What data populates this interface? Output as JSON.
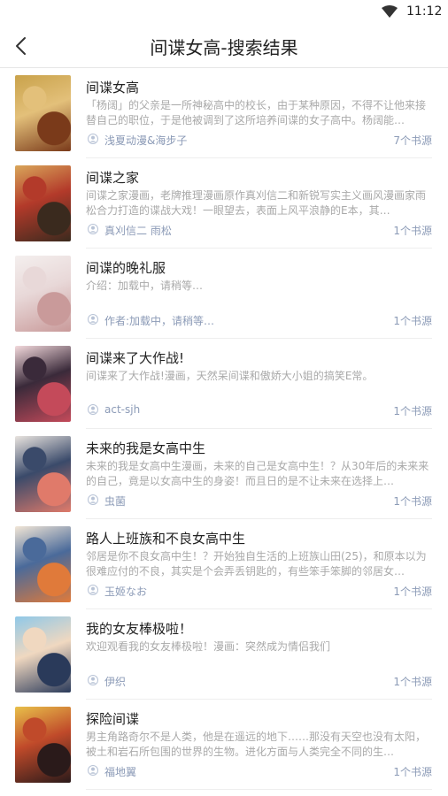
{
  "status": {
    "time": "11:12",
    "wifi_icon": "wifi-icon"
  },
  "toolbar": {
    "back_icon": "chevron-left-icon",
    "title": "间谍女高-搜索结果"
  },
  "results": [
    {
      "title": "间谍女高",
      "desc": "「杨阔」的父亲是一所神秘高中的校长，由于某种原因，不得不让他来接替自己的职位，于是他被调到了这所培养间谍的女子高中。杨阔能…",
      "author": "浅夏动漫&海步子",
      "sources": "7个书源",
      "cover_colors": [
        "#c9a24a",
        "#7a3a1a",
        "#e3c07a"
      ]
    },
    {
      "title": "间谍之家",
      "desc": "间谍之家漫画，老牌推理漫画原作真刈信二和新锐写实主义画风漫画家雨松合力打造的谍战大戏！一眼望去，表面上风平浪静的E本，其…",
      "author": "真刈信二 雨松",
      "sources": "1个书源",
      "cover_colors": [
        "#d9a65a",
        "#3a2a1e",
        "#b33a2a"
      ]
    },
    {
      "title": "间谍的晚礼服",
      "desc": "介绍：加载中，请稍等…",
      "author": "作者:加载中，请稍等…",
      "sources": "1个书源",
      "cover_colors": [
        "#f4efee",
        "#c99a9a",
        "#e8d8d8"
      ]
    },
    {
      "title": "间谍来了大作战!",
      "desc": "间谍来了大作战!漫画，天然呆间谍和傲娇大小姐的搞笑E常。",
      "author": "act-sjh",
      "sources": "1个书源",
      "cover_colors": [
        "#f3d9dc",
        "#c44a5a",
        "#3a2a3a"
      ]
    },
    {
      "title": "未来的我是女高中生",
      "desc": "未来的我是女高中生漫画，未来的自己是女高中生！？从30年后的未来来的自己，竟是以女高中生的身姿！而且日的是不让未来在选择上…",
      "author": "虫菌",
      "sources": "1个书源",
      "cover_colors": [
        "#e9e4df",
        "#e07a6a",
        "#3a4a6a"
      ]
    },
    {
      "title": "路人上班族和不良女高中生",
      "desc": "邻居是你不良女高中生！？开始独自生活的上班族山田(25)，和原本以为很难应付的不良，其实是个会弄丢钥匙的，有些笨手笨脚的邻居女…",
      "author": "玉姬なお",
      "sources": "1个书源",
      "cover_colors": [
        "#f2e6d6",
        "#e07a3a",
        "#4a6a9a"
      ]
    },
    {
      "title": "我的女友棒极啦！",
      "desc": "欢迎观看我的女友棒极啦！漫画：突然成为情侣我们",
      "author": "伊织",
      "sources": "1个书源",
      "cover_colors": [
        "#8fc8e8",
        "#2a3a5a",
        "#f0d8c0"
      ]
    },
    {
      "title": "探险间谍",
      "desc": "男主角路奇尔不是人类，他是在遥远的地下……那没有天空也没有太阳，被土和岩石所包围的世界的生物。进化方面与人类完全不同的生…",
      "author": "福地翼",
      "sources": "1个书源",
      "cover_colors": [
        "#e8c04a",
        "#2a1a1a",
        "#c04a2a"
      ]
    }
  ]
}
